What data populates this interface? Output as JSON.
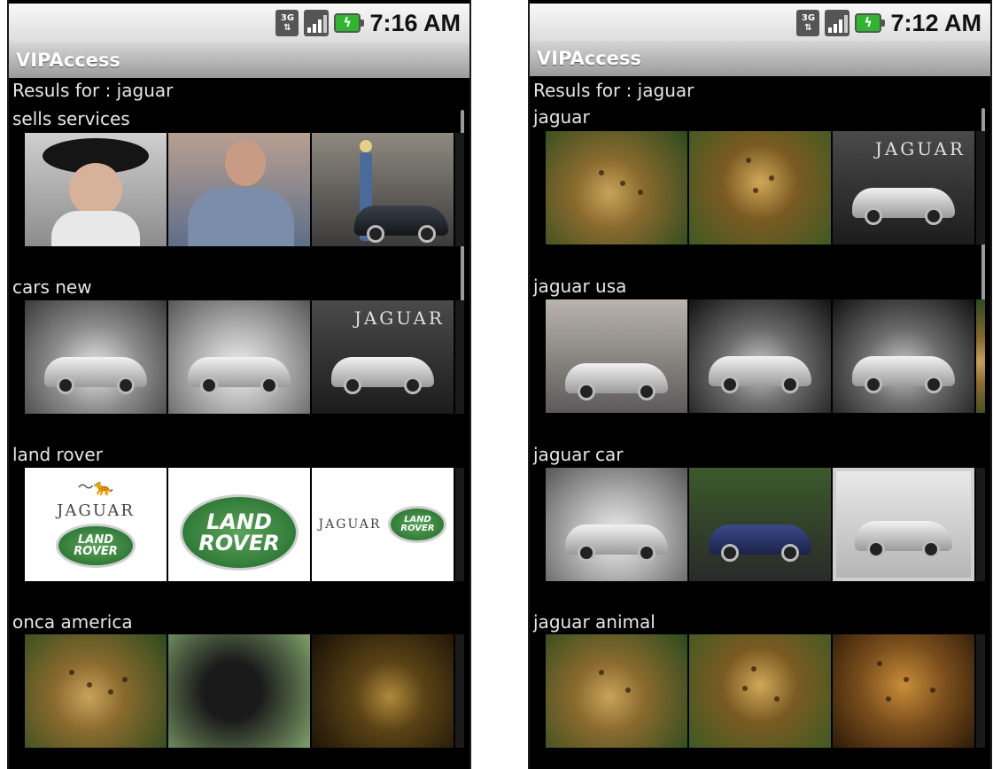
{
  "screens": [
    {
      "status": {
        "clock": "7:16 AM",
        "network": "3G"
      },
      "app_title": "VIPAccess",
      "results_label": "Resuls for : jaguar",
      "sections": [
        {
          "label": "sells  services"
        },
        {
          "label": "cars  new",
          "brand_text": "JAGUAR"
        },
        {
          "label": "land  rover",
          "logo_brand": "JAGUAR",
          "logo_line1": "LAND",
          "logo_line2": "ROVER"
        },
        {
          "label": "onca  america"
        }
      ]
    },
    {
      "status": {
        "clock": "7:12 AM",
        "network": "3G"
      },
      "app_title": "VIPAccess",
      "results_label": "Resuls for : jaguar",
      "sections": [
        {
          "label": "jaguar",
          "brand_text": "JAGUAR"
        },
        {
          "label": "jaguar usa"
        },
        {
          "label": "jaguar car"
        },
        {
          "label": "jaguar animal"
        }
      ]
    }
  ],
  "colors": {
    "background": "#000000",
    "title_bar": "#a8a8a8",
    "status_bar": "#e8e8e8",
    "text": "#e6e6e6",
    "battery": "#2fb52f",
    "land_rover_green": "#1f6a2a"
  }
}
